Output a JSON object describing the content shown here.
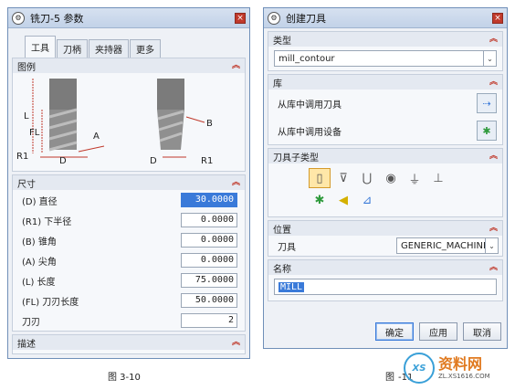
{
  "left_dialog": {
    "title": "铣刀-5 参数",
    "tabs": [
      {
        "label": "工具",
        "active": true
      },
      {
        "label": "刀柄",
        "active": false
      },
      {
        "label": "夹持器",
        "active": false
      },
      {
        "label": "更多",
        "active": false
      }
    ],
    "legend_section": {
      "title": "图例",
      "diagram_labels": {
        "L": "L",
        "FL": "FL",
        "R1": "R1",
        "D": "D",
        "A": "A",
        "B": "B"
      }
    },
    "dimensions": {
      "title": "尺寸",
      "rows": [
        {
          "label": "(D) 直径",
          "value": "30.0000",
          "selected": true
        },
        {
          "label": "(R1) 下半径",
          "value": "0.0000"
        },
        {
          "label": "(B) 锥角",
          "value": "0.0000"
        },
        {
          "label": "(A) 尖角",
          "value": "0.0000"
        },
        {
          "label": "(L) 长度",
          "value": "75.0000"
        },
        {
          "label": "(FL) 刀刃长度",
          "value": "50.0000"
        },
        {
          "label": "刀刃",
          "value": "2"
        }
      ]
    },
    "description_section": {
      "title": "描述"
    }
  },
  "right_dialog": {
    "title": "创建刀具",
    "type_section": {
      "title": "类型",
      "value": "mill_contour"
    },
    "library_section": {
      "title": "库",
      "items": [
        {
          "label": "从库中调用刀具",
          "icon": "library-tool-icon"
        },
        {
          "label": "从库中调用设备",
          "icon": "library-device-icon"
        }
      ]
    },
    "subtype_section": {
      "title": "刀具子类型",
      "row1": [
        "end-mill-icon",
        "chamfer-mill-icon",
        "ball-mill-icon",
        "spherical-mill-icon",
        "t-cutter-icon",
        "barrel-cutter-icon"
      ],
      "row2": [
        "thread-mill-icon",
        "probe-icon",
        "generic-tool-icon"
      ],
      "glyphs_row1": [
        "▯",
        "⊽",
        "⋃",
        "◉",
        "⏚",
        "⊥"
      ],
      "glyphs_row2": [
        "✱",
        "◀",
        "⊿"
      ]
    },
    "position_section": {
      "title": "位置",
      "tool_label": "刀具",
      "tool_value": "GENERIC_MACHINE"
    },
    "name_section": {
      "title": "名称",
      "value": "MILL"
    },
    "buttons": {
      "ok": "确定",
      "apply": "应用",
      "cancel": "取消"
    }
  },
  "captions": {
    "left": "图 3-10",
    "right_prefix": "图",
    "right_suffix": "-11"
  },
  "watermark": {
    "logo": "XS",
    "main": "资料网",
    "sub": "ZL.XS1616.COM"
  },
  "colors": {
    "accent": "#3a7ad9",
    "close": "#c0392b",
    "chevron": "#c0392b",
    "tool_gray": "#8a8a8a"
  }
}
